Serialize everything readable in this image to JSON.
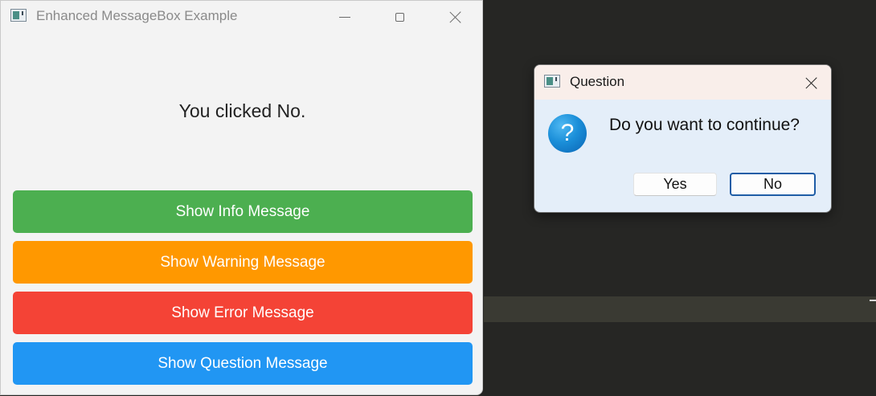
{
  "main_window": {
    "title": "Enhanced MessageBox Example",
    "result_text": "You clicked No.",
    "buttons": {
      "info": "Show Info Message",
      "warning": "Show Warning Message",
      "error": "Show Error Message",
      "question": "Show Question Message"
    }
  },
  "dialog": {
    "title": "Question",
    "message": "Do you want to continue?",
    "icon": "question-icon",
    "buttons": {
      "yes": "Yes",
      "no": "No"
    }
  },
  "colors": {
    "info": "#4caf50",
    "warning": "#ff9800",
    "error": "#f44336",
    "question": "#2196f3"
  }
}
